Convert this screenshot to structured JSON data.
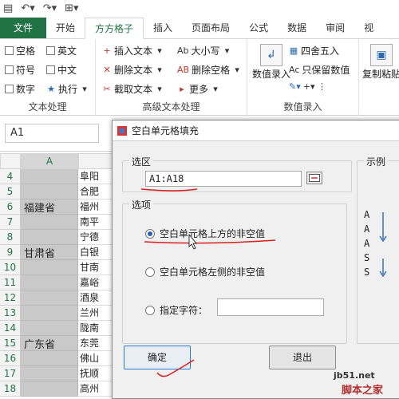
{
  "qat": {
    "save_icon": "save-icon",
    "undo_icon": "undo-icon",
    "redo_icon": "redo-icon"
  },
  "tabs": [
    "开始",
    "方方格子",
    "插入",
    "页面布局",
    "公式",
    "数据",
    "审阅",
    "视"
  ],
  "file_tab": "文件",
  "ribbon": {
    "text_group": {
      "label": "文本处理",
      "checks": [
        "空格",
        "英文",
        "符号",
        "中文",
        "数字"
      ],
      "exec": "执行"
    },
    "adv_group": {
      "label": "高级文本处理",
      "items": [
        "插入文本",
        "删除文本",
        "截取文本",
        "大小写",
        "删除空格",
        "更多"
      ]
    },
    "num_group": {
      "label": "数值录入",
      "big_button": "数值录入",
      "items": [
        "四舍五入",
        "只保留数值"
      ]
    },
    "paste_button": "复制粘贴"
  },
  "namebox": "A1",
  "sheet": {
    "col_a": "A",
    "rows": [
      "4",
      "5",
      "6",
      "7",
      "8",
      "9",
      "10",
      "11",
      "12",
      "13",
      "14",
      "15",
      "16",
      "17",
      "18"
    ],
    "col_b": [
      "阜阳",
      "合肥",
      "福州",
      "南平",
      "宁德",
      "白银",
      "甘南",
      "嘉峪",
      "酒泉",
      "兰州",
      "陇南",
      "东莞",
      "佛山",
      "抚顺",
      "高州"
    ],
    "provinces": [
      "福建省",
      "甘肃省",
      "广东省"
    ]
  },
  "dialog": {
    "title": "空白单元格填充",
    "selection_legend": "选区",
    "selection_value": "A1:A18",
    "options_legend": "选项",
    "opt_above": "空白单元格上方的非空值",
    "opt_left": "空白单元格左侧的非空值",
    "opt_char": "指定字符：",
    "char_value": "",
    "example_legend": "示例",
    "example_values": [
      "A",
      "A",
      "A",
      "S",
      "S"
    ],
    "ok": "确定",
    "cancel": "退出"
  },
  "watermark": {
    "line1": "jb51.net",
    "line2": "脚本之家"
  }
}
